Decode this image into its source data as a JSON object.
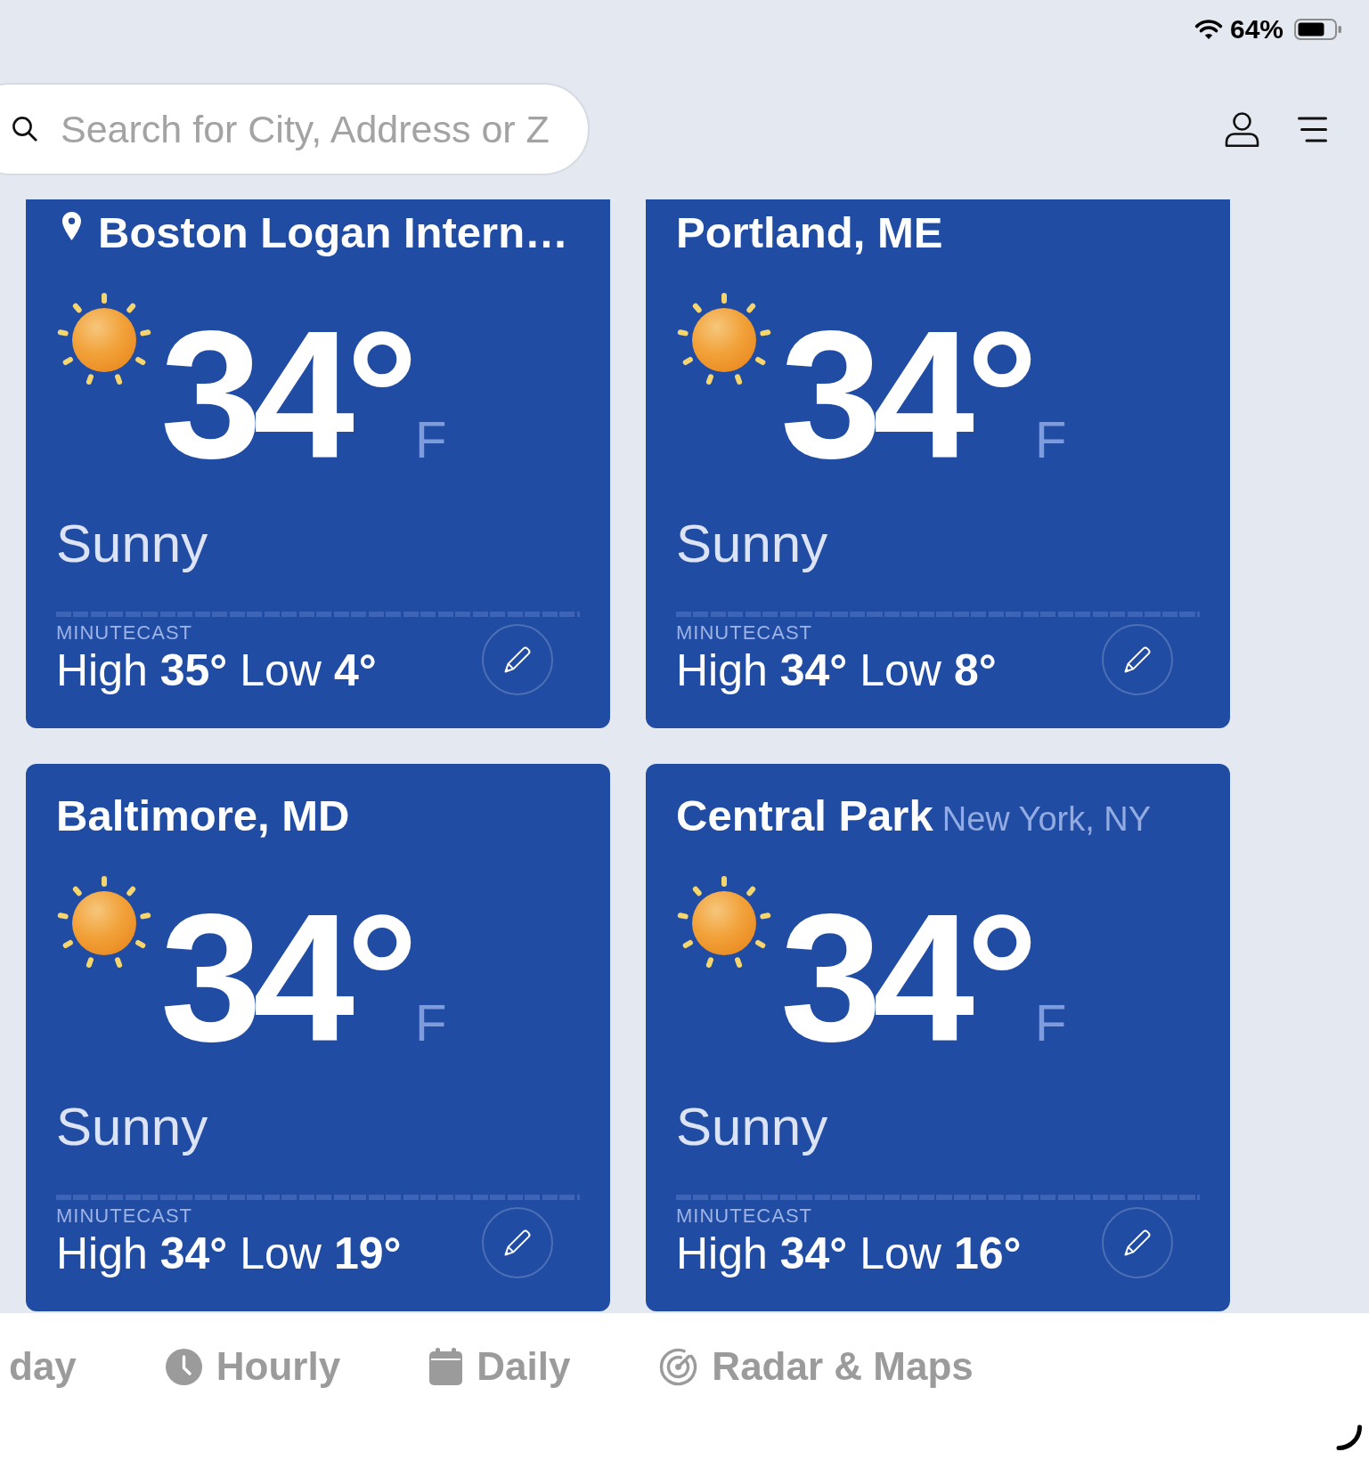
{
  "status_bar": {
    "battery": "64%"
  },
  "search": {
    "placeholder": "Search for City, Address or Z"
  },
  "locations": [
    {
      "name": "Boston Logan Intern…",
      "current_location": true,
      "temperature": "34°",
      "unit": "F",
      "condition": "Sunny",
      "minutecast": "MINUTECAST",
      "high_low": "High **35°** Low **4°**"
    },
    {
      "name": "Portland, ME",
      "current_location": false,
      "temperature": "34°",
      "unit": "F",
      "condition": "Sunny",
      "minutecast": "MINUTECAST",
      "high_low": "High **34°** Low **8°**"
    },
    {
      "name": "Baltimore, MD",
      "current_location": false,
      "temperature": "34°",
      "unit": "F",
      "condition": "Sunny",
      "minutecast": "MINUTECAST",
      "high_low": "High **34°** Low **19°**"
    },
    {
      "name": "Central Park",
      "region": "New York, NY",
      "current_location": false,
      "temperature": "34°",
      "unit": "F",
      "condition": "Sunny",
      "minutecast": "MINUTECAST",
      "high_low": "High **34°** Low **16°**"
    }
  ],
  "tabs": [
    {
      "label": "day",
      "selected": false
    },
    {
      "label": "Hourly",
      "selected": false
    },
    {
      "label": "Daily",
      "selected": false
    },
    {
      "label": "Radar & Maps",
      "selected": false
    }
  ]
}
